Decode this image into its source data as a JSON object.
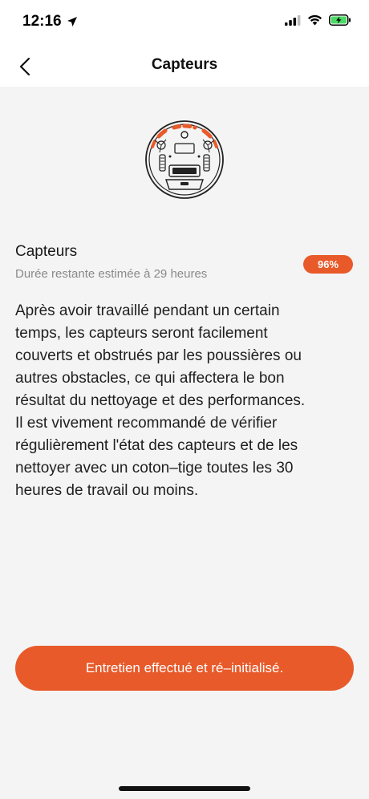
{
  "status_bar": {
    "time": "12:16",
    "icons": [
      "location-arrow-icon",
      "cellular-signal-icon",
      "wifi-icon",
      "battery-charging-icon"
    ]
  },
  "nav": {
    "title": "Capteurs",
    "back_icon": "chevron-left-icon"
  },
  "illustration": {
    "icon": "robot-vacuum-bottom-icon",
    "highlight_color": "#e85a2a"
  },
  "sensor": {
    "title": "Capteurs",
    "remaining": "Durée restante estimée à 29 heures",
    "percent": "96%",
    "percent_value": 96
  },
  "description": "Après avoir travaillé pendant un certain\ntemps, les capteurs seront facilement\ncouverts et obstrués par les poussières ou\nautres obstacles, ce qui affectera le bon\nrésultat du nettoyage et des performances.\nIl est vivement recommandé de vérifier\nrégulièrement l'état des capteurs et de les\nnettoyer avec un coton–tige toutes les 30\nheures de travail ou moins.",
  "reset_button": {
    "label": "Entretien effectué et ré–initialisé."
  },
  "colors": {
    "accent": "#e85a2a",
    "background": "#f4f4f4",
    "header": "#ffffff"
  }
}
